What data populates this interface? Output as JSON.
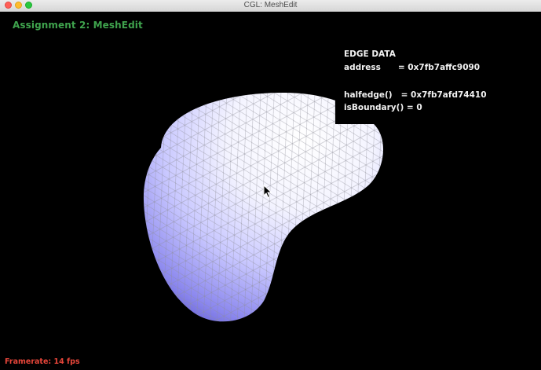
{
  "window": {
    "title": "CGL: MeshEdit"
  },
  "app": {
    "title": "Assignment 2: MeshEdit"
  },
  "edge_data": {
    "heading": "EDGE DATA",
    "address_line": "address      = 0x7fb7affc9090",
    "halfedge_line": "halfedge()   = 0x7fb7afd74410",
    "boundary_line": "isBoundary() = 0"
  },
  "status": {
    "framerate": "Framerate: 14 fps"
  },
  "colors": {
    "mesh_light": "#ffffff",
    "mesh_mid": "#c9c8ff",
    "mesh_dark": "#6f6ae0",
    "title_green": "#3fa34d",
    "framerate_red": "#e8463a"
  }
}
